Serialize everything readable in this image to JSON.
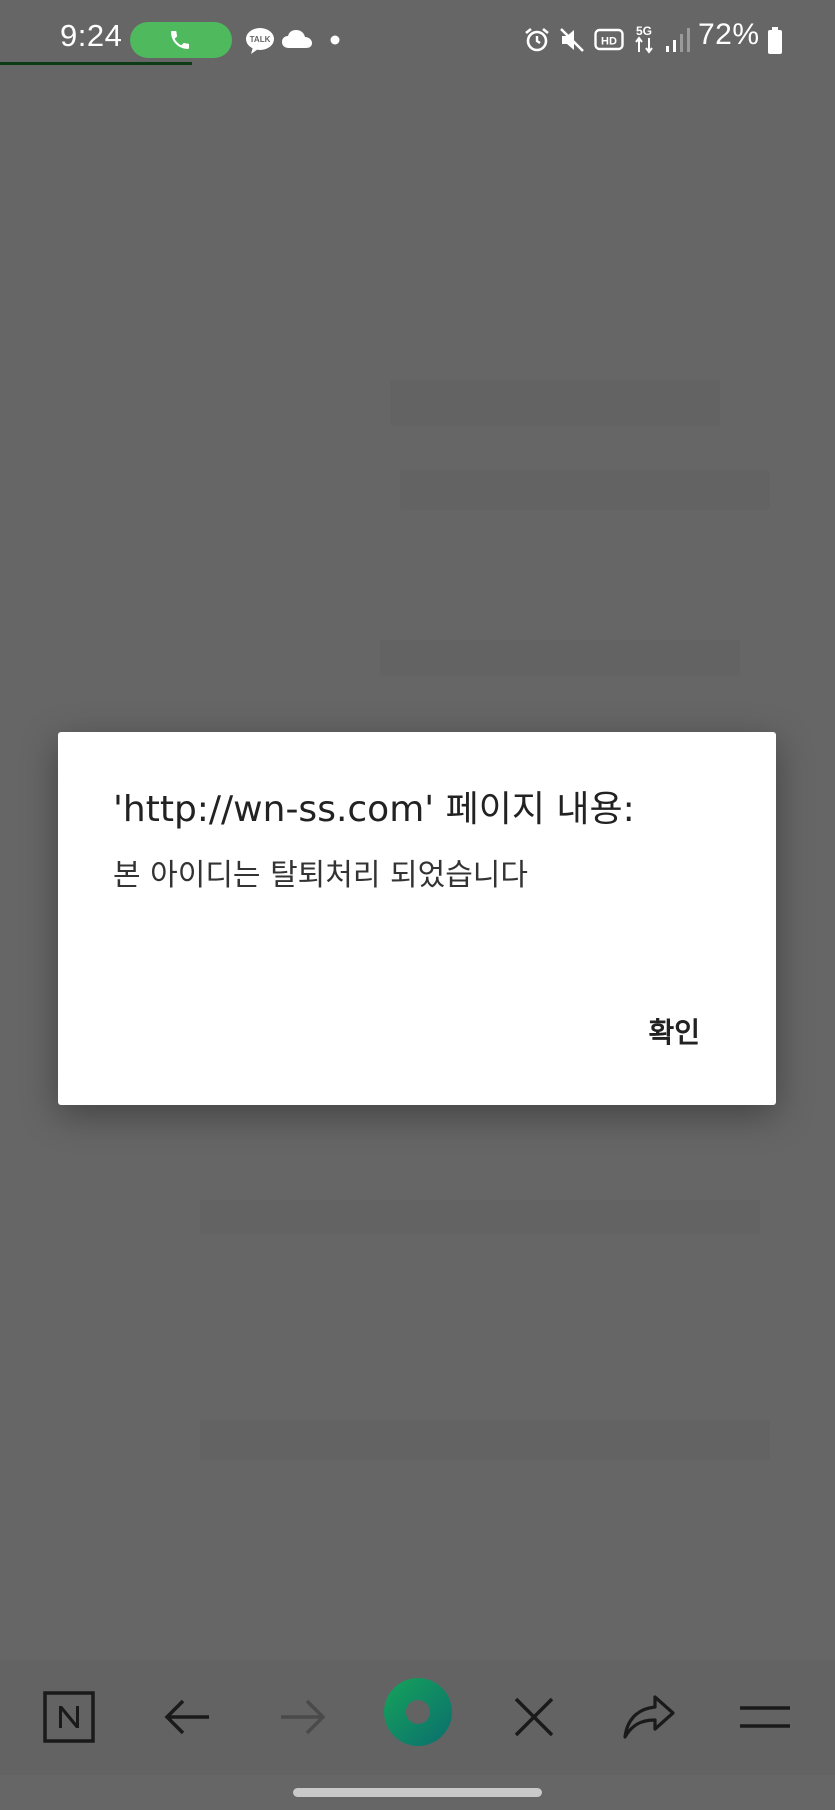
{
  "status_bar": {
    "time": "9:24",
    "battery": "72%",
    "icons": [
      "call-icon",
      "kakaotalk-icon",
      "cloud-icon",
      "dot-icon",
      "alarm-icon",
      "mute-icon",
      "hd-icon",
      "5g-icon",
      "signal-icon",
      "battery-icon"
    ],
    "call_color": "#4fb95e"
  },
  "dialog": {
    "title": "'http://wn-ss.com' 페이지 내용:",
    "message": "본 아이디는 탈퇴처리 되었습니다",
    "ok_label": "확인"
  },
  "toolbar": {
    "items": [
      "naver-home-icon",
      "back-arrow-icon",
      "forward-arrow-icon",
      "green-dot-icon",
      "close-icon",
      "share-icon",
      "menu-icon"
    ],
    "accent": "#0a8a4f"
  }
}
